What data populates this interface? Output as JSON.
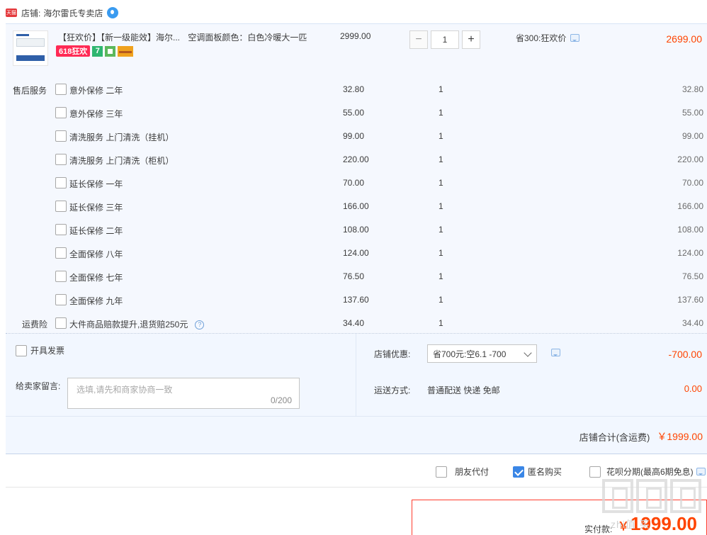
{
  "shop": {
    "badge": "天猫",
    "label": "店铺:",
    "name": "海尔雷氏专卖店"
  },
  "product": {
    "title": "【狂欢价】【新一级能效】海尔...",
    "attrs": "空调面板颜色：白色冷暖大一匹",
    "price": "2999.00",
    "quantity": "1",
    "qty_minus": "−",
    "qty_plus": "+",
    "promo": "省300:狂欢价",
    "subtotal": "2699.00",
    "badges": {
      "b618": "618狂欢",
      "b7": "7"
    }
  },
  "services": {
    "section_label": "售后服务",
    "items": [
      {
        "name": "意外保修 二年",
        "price": "32.80",
        "qty": "1",
        "total": "32.80"
      },
      {
        "name": "意外保修 三年",
        "price": "55.00",
        "qty": "1",
        "total": "55.00"
      },
      {
        "name": "清洗服务 上门清洗（挂机）",
        "price": "99.00",
        "qty": "1",
        "total": "99.00"
      },
      {
        "name": "清洗服务 上门清洗（柜机）",
        "price": "220.00",
        "qty": "1",
        "total": "220.00"
      },
      {
        "name": "延长保修 一年",
        "price": "70.00",
        "qty": "1",
        "total": "70.00"
      },
      {
        "name": "延长保修 三年",
        "price": "166.00",
        "qty": "1",
        "total": "166.00"
      },
      {
        "name": "延长保修 二年",
        "price": "108.00",
        "qty": "1",
        "total": "108.00"
      },
      {
        "name": "全面保修 八年",
        "price": "124.00",
        "qty": "1",
        "total": "124.00"
      },
      {
        "name": "全面保修 七年",
        "price": "76.50",
        "qty": "1",
        "total": "76.50"
      },
      {
        "name": "全面保修 九年",
        "price": "137.60",
        "qty": "1",
        "total": "137.60"
      }
    ]
  },
  "shipping_insurance": {
    "section_label": "运费险",
    "name": "大件商品赔款提升,退货赔250元",
    "help": "?",
    "price": "34.40",
    "qty": "1",
    "total": "34.40"
  },
  "invoice": {
    "label": "开具发票"
  },
  "message": {
    "label": "给卖家留言:",
    "placeholder": "选填,请先和商家协商一致",
    "count": "0/200"
  },
  "coupon": {
    "label": "店铺优惠:",
    "selected": "省700元:空6.1 -700",
    "amount": "-700.00"
  },
  "delivery": {
    "label": "运送方式:",
    "value": "普通配送 快递 免邮",
    "amount": "0.00"
  },
  "shop_total": {
    "label": "店铺合计(含运费)",
    "amount": "￥1999.00"
  },
  "options": {
    "friend_pay": "朋友代付",
    "anonymous": "匿名购买",
    "huabei": "花呗分期(最高6期免息)"
  },
  "payment": {
    "label": "实付款:",
    "yen": "￥",
    "amount": "1999.00"
  },
  "watermark": {
    "text": "zhi值 买"
  }
}
